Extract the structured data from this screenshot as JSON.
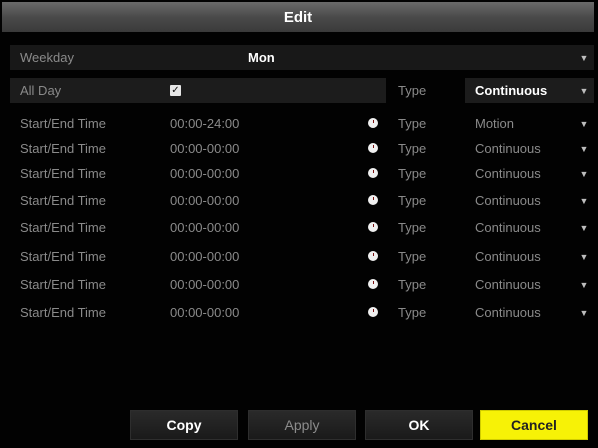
{
  "dialog": {
    "title": "Edit"
  },
  "weekday": {
    "label": "Weekday",
    "value": "Mon"
  },
  "all_day": {
    "label": "All Day",
    "checked": true,
    "check_glyph": "✓",
    "type_label": "Type",
    "type_value": "Continuous"
  },
  "schedule": [
    {
      "label": "Start/End Time",
      "time": "00:00-24:00",
      "type_label": "Type",
      "type_value": "Motion"
    },
    {
      "label": "Start/End Time",
      "time": "00:00-00:00",
      "type_label": "Type",
      "type_value": "Continuous"
    },
    {
      "label": "Start/End Time",
      "time": "00:00-00:00",
      "type_label": "Type",
      "type_value": "Continuous"
    },
    {
      "label": "Start/End Time",
      "time": "00:00-00:00",
      "type_label": "Type",
      "type_value": "Continuous"
    },
    {
      "label": "Start/End Time",
      "time": "00:00-00:00",
      "type_label": "Type",
      "type_value": "Continuous"
    },
    {
      "label": "Start/End Time",
      "time": "00:00-00:00",
      "type_label": "Type",
      "type_value": "Continuous"
    },
    {
      "label": "Start/End Time",
      "time": "00:00-00:00",
      "type_label": "Type",
      "type_value": "Continuous"
    },
    {
      "label": "Start/End Time",
      "time": "00:00-00:00",
      "type_label": "Type",
      "type_value": "Continuous"
    }
  ],
  "buttons": {
    "copy": "Copy",
    "apply": "Apply",
    "ok": "OK",
    "cancel": "Cancel"
  },
  "icons": {
    "dropdown": "chevron-down-icon",
    "clock": "clock-icon",
    "checkbox": "checkmark-icon"
  },
  "colors": {
    "cancel_bg": "#f7f206",
    "title_bar": "#5a5a5a",
    "background": "#020202"
  }
}
